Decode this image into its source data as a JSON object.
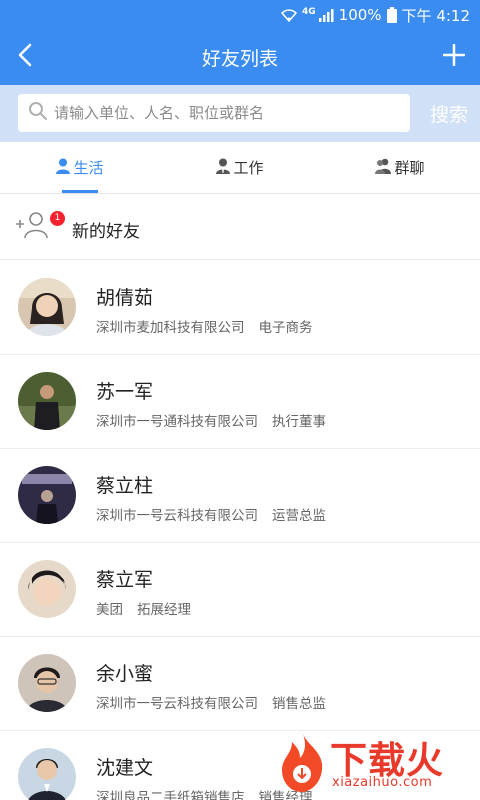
{
  "status_bar": {
    "network": "4G",
    "battery": "100%",
    "time": "下午 4:12"
  },
  "nav": {
    "title": "好友列表"
  },
  "search": {
    "placeholder": "请输入单位、人名、职位或群名",
    "button_label": "搜索"
  },
  "tabs": [
    {
      "label": "生活",
      "icon": "person-icon",
      "active": true
    },
    {
      "label": "工作",
      "icon": "suit-person-icon",
      "active": false
    },
    {
      "label": "群聊",
      "icon": "group-icon",
      "active": false
    }
  ],
  "new_friends": {
    "label": "新的好友",
    "badge": "1"
  },
  "contacts": [
    {
      "name": "胡倩茹",
      "company": "深圳市麦加科技有限公司",
      "role": "电子商务",
      "avatar_color": "#c9a98e"
    },
    {
      "name": "苏一军",
      "company": "深圳市一号通科技有限公司",
      "role": "执行董事",
      "avatar_color": "#5a6b3d"
    },
    {
      "name": "蔡立柱",
      "company": "深圳市一号云科技有限公司",
      "role": "运营总监",
      "avatar_color": "#3b3550"
    },
    {
      "name": "蔡立军",
      "company": "美团",
      "role": "拓展经理",
      "avatar_color": "#d4c3b0"
    },
    {
      "name": "余小蜜",
      "company": "深圳市一号云科技有限公司",
      "role": "销售总监",
      "avatar_color": "#b8a596"
    },
    {
      "name": "沈建文",
      "company": "深圳良品二手纸箱销售店",
      "role": "销售经理",
      "avatar_color": "#9fb3c8"
    }
  ],
  "watermark": {
    "logo_text": "下载火",
    "url": "xiazaihuo.com"
  },
  "colors": {
    "primary": "#3a8cf0",
    "search_bg": "#cfe0f7",
    "badge_red": "#f5222d",
    "watermark_red": "#e8392a"
  }
}
